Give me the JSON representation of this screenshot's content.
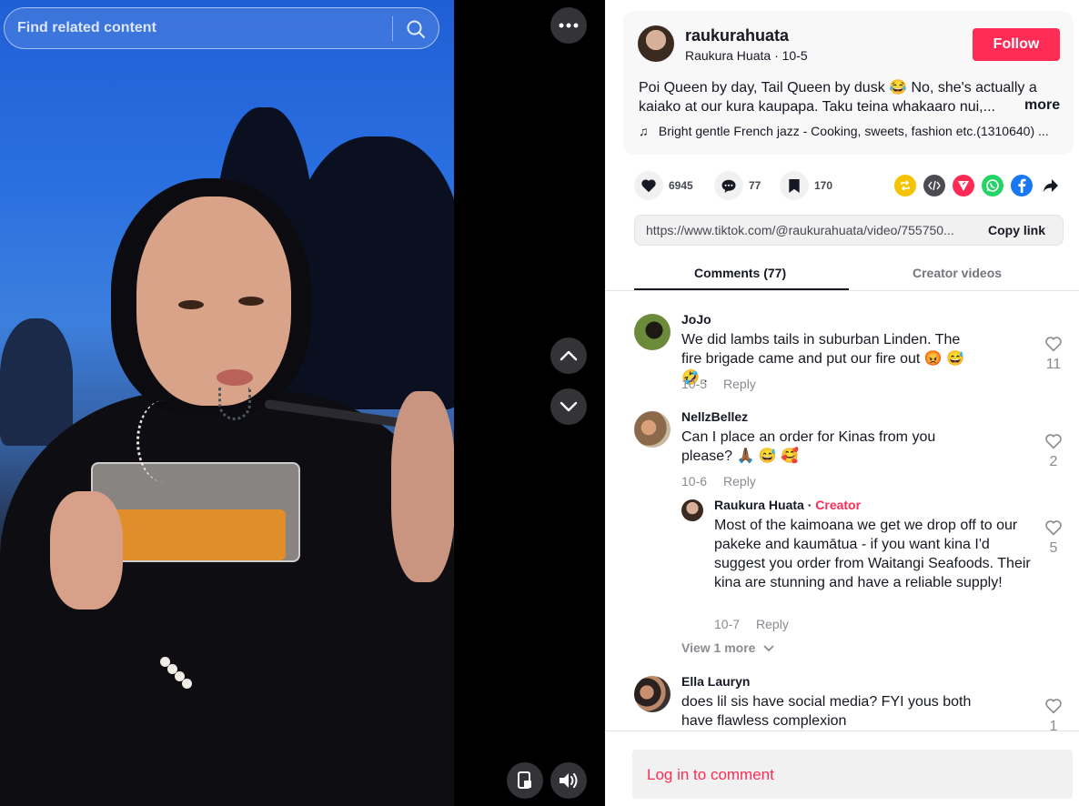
{
  "search": {
    "placeholder": "Find related content"
  },
  "author": {
    "username": "raukurahuata",
    "nickname": "Raukura Huata",
    "date": "10-5",
    "follow_label": "Follow",
    "description": "Poi Queen by day, Tail Queen by dusk 😂 No, she's actually a kaiako at our kura kaupapa. Taku teina whakaaro nui,...",
    "more_label": "more",
    "music": "Bright gentle French jazz - Cooking, sweets, fashion etc.(1310640) ..."
  },
  "actions": {
    "likes": "6945",
    "comments": "77",
    "saves": "170"
  },
  "link": {
    "url": "https://www.tiktok.com/@raukurahuata/video/755750...",
    "copy_label": "Copy link"
  },
  "tabs": [
    {
      "label": "Comments (77)"
    },
    {
      "label": "Creator videos"
    }
  ],
  "comments": [
    {
      "name": "JoJo",
      "text": "We did lambs tails in suburban Linden. The fire brigade came and put our fire out 😡 😅 🤣 .",
      "date": "10-5",
      "reply": "Reply",
      "likes": "11"
    },
    {
      "name": "NellzBellez",
      "text": "Can I place an order for Kinas from you please? 🙏🏾 😅 🥰",
      "date": "10-6",
      "reply": "Reply",
      "likes": "2"
    },
    {
      "name": "Raukura Huata",
      "creator": "Creator",
      "text": "Most of the kaimoana we get we drop off to our pakeke and kaumātua - if you want kina I'd suggest you order from Waitangi Seafoods. Their kina are stunning and have a reliable supply!",
      "date": "10-7",
      "reply": "Reply",
      "likes": "5"
    },
    {
      "name": "Ella Lauryn",
      "text": "does lil sis have social media? FYI yous both have flawless complexion",
      "likes": "1"
    }
  ],
  "view_more": "View 1 more",
  "login": {
    "label": "Log in to comment"
  },
  "colors": {
    "accent": "#fe2c55",
    "text": "#161823",
    "muted": "#8a8b91"
  }
}
